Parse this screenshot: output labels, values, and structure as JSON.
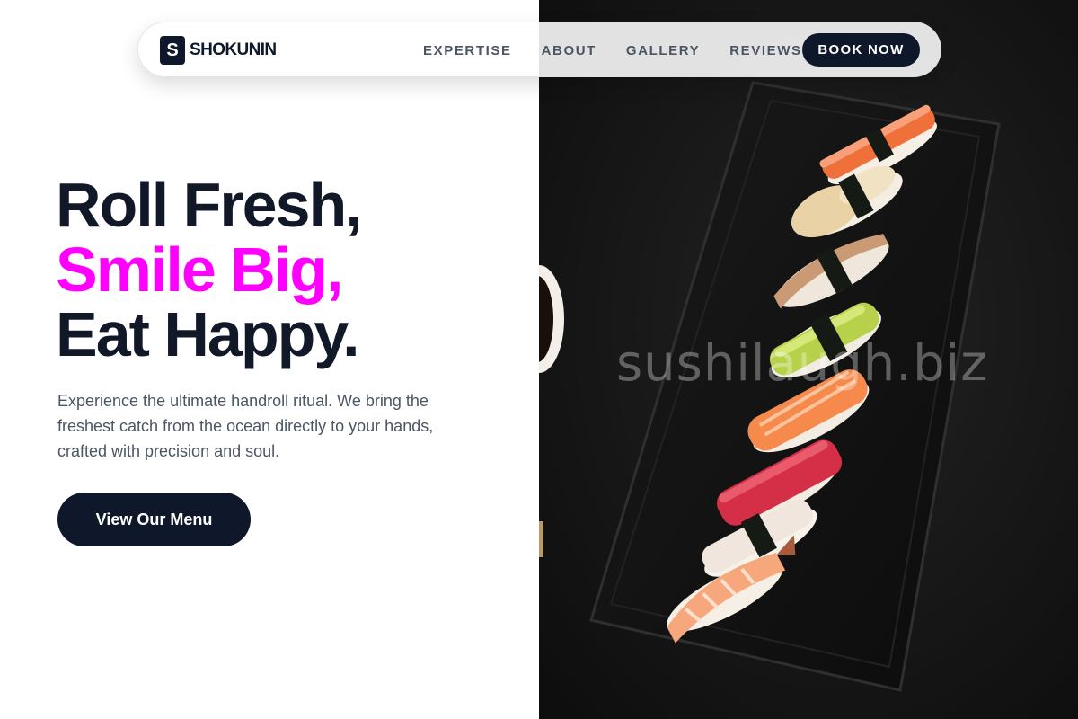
{
  "brand": {
    "mark": "S",
    "name": "SHOKUNIN"
  },
  "nav": {
    "links": [
      "EXPERTISE",
      "ABOUT",
      "GALLERY",
      "REVIEWS"
    ],
    "cta_label": "BOOK NOW"
  },
  "hero": {
    "line1": "Roll Fresh,",
    "line2": "Smile Big,",
    "line3": "Eat Happy.",
    "description": "Experience the ultimate handroll ritual. We bring the freshest catch from the ocean directly to your hands, crafted with precision and soul.",
    "cta_label": "View Our Menu"
  },
  "photo": {
    "watermark": "sushilaugh.biz"
  },
  "colors": {
    "navy": "#0f172a",
    "accent_magenta": "#ff00ff",
    "body_text": "#4b5563",
    "photo_background": "#171717"
  }
}
